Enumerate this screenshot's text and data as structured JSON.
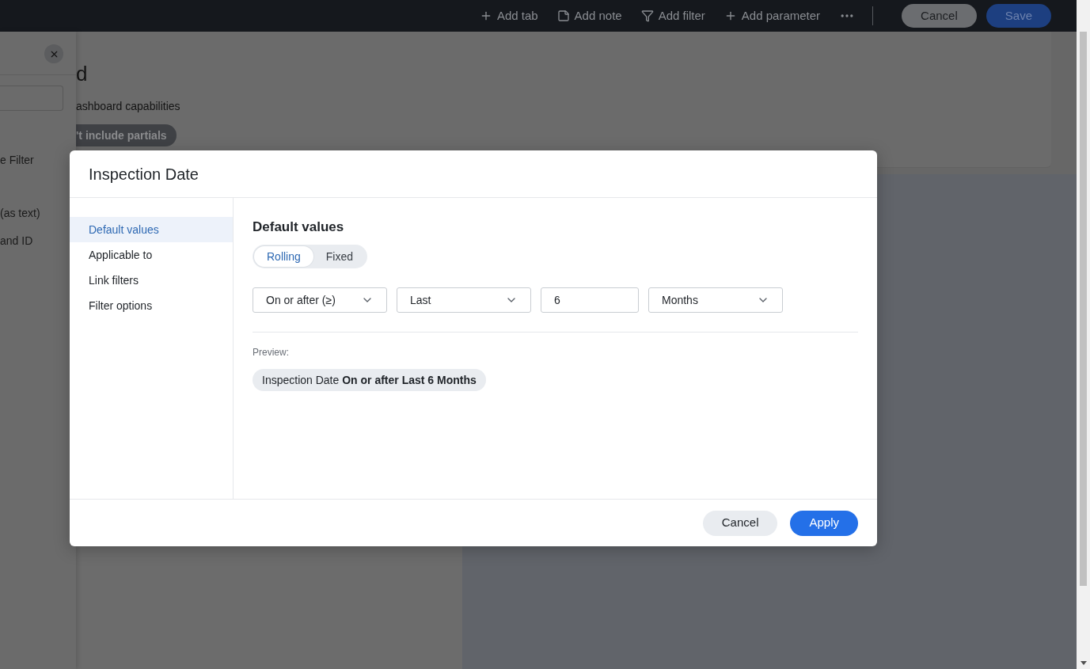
{
  "toolbar": {
    "actions": [
      {
        "label": "Add tab",
        "kind": "plus"
      },
      {
        "label": "Add note",
        "kind": "note"
      },
      {
        "label": "Add filter",
        "kind": "filter"
      },
      {
        "label": "Add parameter",
        "kind": "plus"
      }
    ],
    "buttons": [
      {
        "label": "Cancel",
        "kind": "secondary"
      },
      {
        "label": "Save",
        "kind": "primary"
      }
    ]
  },
  "side_panel": {
    "items": [
      "e Filter",
      "(as text)",
      "and ID"
    ]
  },
  "dashboard": {
    "title": "d",
    "subtitle": "ashboard capabilities",
    "chip": "'t include partials"
  },
  "dialog": {
    "title": "Inspection Date",
    "nav": [
      {
        "label": "Default values",
        "selected": true
      },
      {
        "label": "Applicable to",
        "selected": false
      },
      {
        "label": "Link filters",
        "selected": false
      },
      {
        "label": "Filter options",
        "selected": false
      }
    ],
    "section_title": "Default values",
    "modes": [
      {
        "label": "Rolling",
        "selected": true
      },
      {
        "label": "Fixed",
        "selected": false
      }
    ],
    "fields": [
      {
        "kind": "select",
        "value": "On or after (≥)"
      },
      {
        "kind": "select",
        "value": "Last"
      },
      {
        "kind": "input",
        "value": "6"
      },
      {
        "kind": "select",
        "value": "Months"
      }
    ],
    "preview_label": "Preview:",
    "preview": "Inspection Date **On or after Last 6 Months**",
    "buttons": [
      {
        "label": "Cancel",
        "kind": "secondary"
      },
      {
        "label": "Apply",
        "kind": "primary"
      }
    ]
  }
}
